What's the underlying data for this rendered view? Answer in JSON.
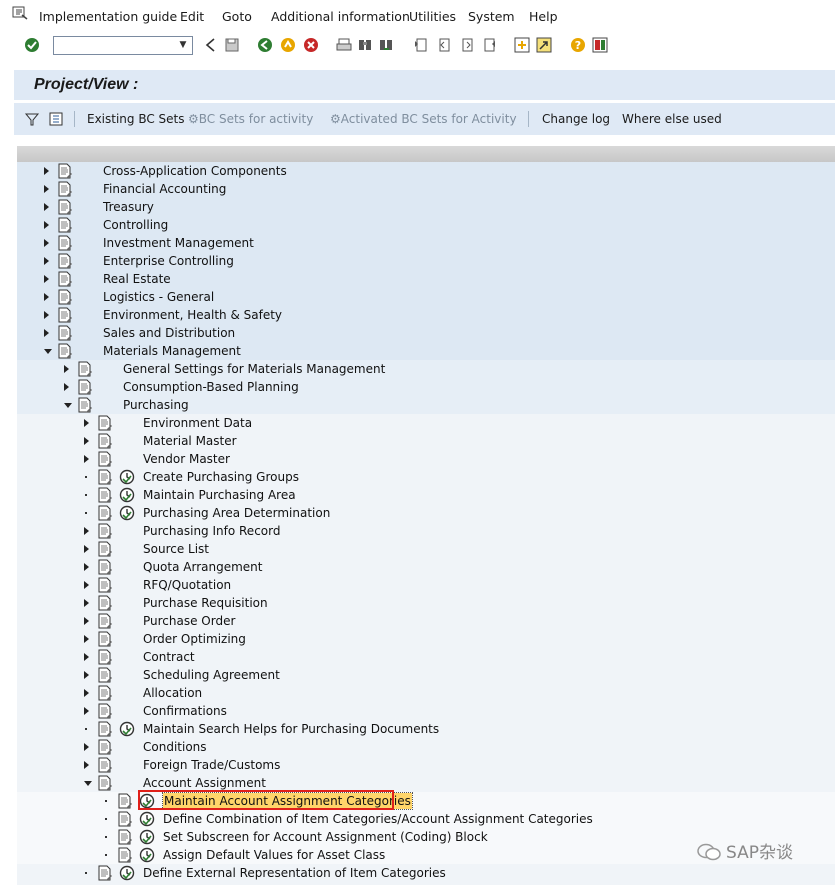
{
  "menu": {
    "items": [
      "Implementation guide",
      "Edit",
      "Goto",
      "Additional information",
      "Utilities",
      "System",
      "Help"
    ]
  },
  "toolbar": {
    "command_field_value": "",
    "icons": [
      "enter-icon",
      "back-icon",
      "save-icon",
      "green-back-icon",
      "exit-icon",
      "cancel-icon",
      "print-icon",
      "find-icon",
      "find-next-icon",
      "first-page-icon",
      "prev-page-icon",
      "next-page-icon",
      "last-page-icon",
      "new-session-icon",
      "shortcut-icon",
      "help-icon",
      "customize-layout-icon"
    ]
  },
  "title": "Project/View   :",
  "app_toolbar": {
    "existing_bc_sets": "Existing BC Sets",
    "bc_sets_for_activity": "BC Sets for activity",
    "activated_bc_sets": "Activated BC Sets for Activity",
    "change_log": "Change log",
    "where_else_used": "Where else used"
  },
  "tree": {
    "level1": [
      "Cross-Application Components",
      "Financial Accounting",
      "Treasury",
      "Controlling",
      "Investment Management",
      "Enterprise Controlling",
      "Real Estate",
      "Logistics - General",
      "Environment, Health & Safety",
      "Sales and Distribution",
      "Materials Management"
    ],
    "level2": [
      "General Settings for Materials Management",
      "Consumption-Based Planning",
      "Purchasing"
    ],
    "level3": [
      "Environment Data",
      "Material Master",
      "Vendor Master",
      "Create Purchasing Groups",
      "Maintain Purchasing Area",
      "Purchasing Area Determination",
      "Purchasing Info Record",
      "Source List",
      "Quota Arrangement",
      "RFQ/Quotation",
      "Purchase Requisition",
      "Purchase Order",
      "Order Optimizing",
      "Contract",
      "Scheduling Agreement",
      "Allocation",
      "Confirmations",
      "Maintain Search Helps for Purchasing Documents",
      "Conditions",
      "Foreign Trade/Customs",
      "Account Assignment"
    ],
    "level4": [
      "Maintain Account Assignment Categories",
      "Define Combination of Item Categories/Account Assignment Categories",
      "Set Subscreen for Account Assignment (Coding) Block",
      "Assign Default Values for Asset Class"
    ],
    "after": "Define External Representation of Item Categories"
  },
  "watermark": "SAP杂谈",
  "colors": {
    "band_level1": "#dde8f3",
    "band_level3": "#f0f4f8",
    "band_level4": "#f7f9fb",
    "selection": "#ffd56a",
    "highlight_border": "#e0201a"
  }
}
